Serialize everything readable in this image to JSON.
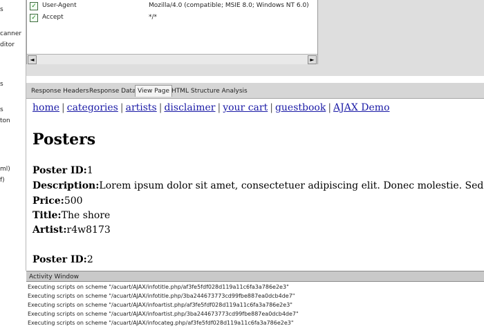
{
  "left_panel": {
    "items": [
      "s",
      "canner",
      "ditor",
      "s",
      "s",
      "ton",
      "ml)",
      "f)"
    ]
  },
  "request_headers": [
    {
      "name": "User-Agent",
      "value": "Mozilla/4.0 (compatible; MSIE 8.0; Windows NT 6.0)",
      "checked": true
    },
    {
      "name": "Accept",
      "value": "*/*",
      "checked": true
    }
  ],
  "scrollbar": {
    "left_arrow": "◄",
    "right_arrow": "►"
  },
  "tabs": [
    {
      "label": "Response Headers",
      "active": false
    },
    {
      "label": "Response Data",
      "active": false
    },
    {
      "label": "View Page",
      "active": true
    },
    {
      "label": "HTML Structure Analysis",
      "active": false
    }
  ],
  "view_page": {
    "nav": [
      "home",
      "categories",
      "artists",
      "disclaimer",
      "your cart",
      "guestbook",
      "AJAX Demo"
    ],
    "separator": "|",
    "heading": "Posters",
    "poster1": {
      "id_label": "Poster ID:",
      "id": "1",
      "desc_label": "Description:",
      "desc": "Lorem ipsum dolor sit amet, consectetuer adipiscing elit. Donec molestie. Sed aliquam sem ut arcu.",
      "price_label": "Price:",
      "price": "500",
      "title_label": "Title:",
      "title": "The shore",
      "artist_label": "Artist:",
      "artist": "r4w8173"
    },
    "poster2": {
      "id_label": "Poster ID:",
      "id": "2"
    }
  },
  "activity": {
    "title": "Activity Window",
    "lines": [
      "Executing scripts on scheme \"/acuart/AJAX/infotitle.php/af3fe5fdf028d119a11c6fa3a786e2e3\"",
      "Executing scripts on scheme \"/acuart/AJAX/infotitle.php/3ba244673773cd99fbe887ea0dcb4de7\"",
      "Executing scripts on scheme \"/acuart/AJAX/infoartist.php/af3fe5fdf028d119a11c6fa3a786e2e3\"",
      "Executing scripts on scheme \"/acuart/AJAX/infoartist.php/3ba244673773cd99fbe887ea0dcb4de7\"",
      "Executing scripts on scheme \"/acuart/AJAX/infocateg.php/af3fe5fdf028d119a11c6fa3a786e2e3\""
    ]
  }
}
